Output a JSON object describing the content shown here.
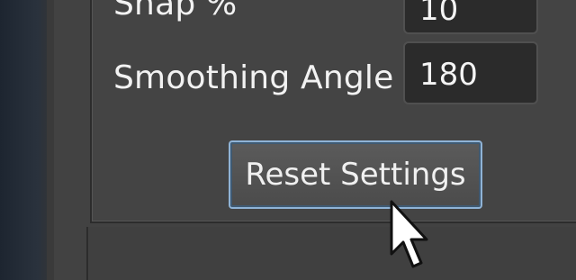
{
  "settings": {
    "snap_label": "Snap %",
    "snap_value": "10",
    "smoothing_label": "Smoothing Angle",
    "smoothing_value": "180",
    "reset_label": "Reset Settings"
  },
  "icons": {
    "cursor": "mouse-pointer-icon"
  }
}
